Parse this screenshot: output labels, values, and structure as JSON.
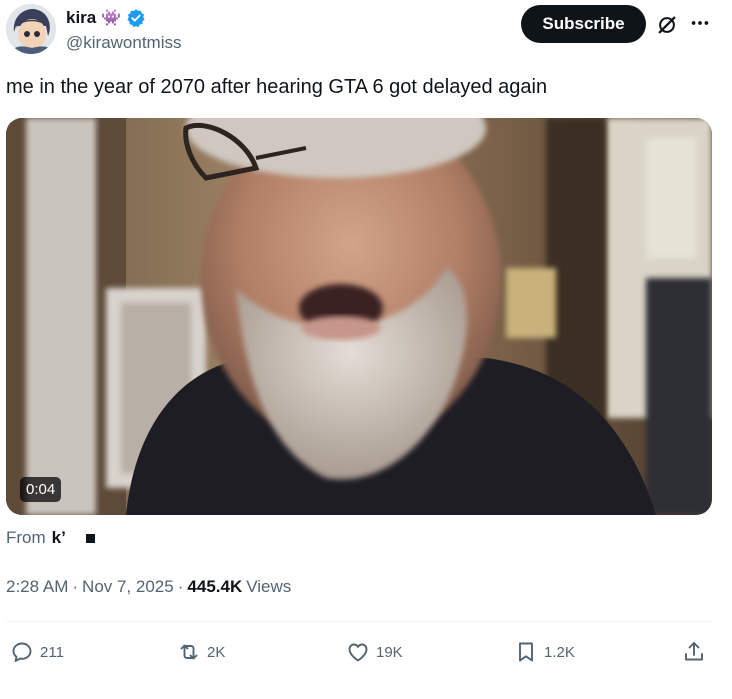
{
  "author": {
    "display_name": "kira",
    "name_emoji": "👾",
    "handle": "@kirawontmiss",
    "verified": true
  },
  "header": {
    "subscribe_label": "Subscribe",
    "grok_icon": "grok-icon",
    "more_icon": "more-icon"
  },
  "tweet": {
    "text": "me in the year of 2070 after hearing GTA 6 got delayed again"
  },
  "media": {
    "type": "video",
    "duration": "0:04"
  },
  "source": {
    "from_label": "From",
    "from_user": "k’"
  },
  "meta": {
    "time": "2:28 AM",
    "date": "Nov 7, 2025",
    "views_count": "445.4K",
    "views_label": "Views"
  },
  "actions": {
    "replies": "211",
    "reposts": "2K",
    "likes": "19K",
    "bookmarks": "1.2K"
  },
  "colors": {
    "text_primary": "#0f1419",
    "text_secondary": "#536471",
    "verified_blue": "#1d9bf0",
    "emoji_purple": "#8a3fb8"
  }
}
